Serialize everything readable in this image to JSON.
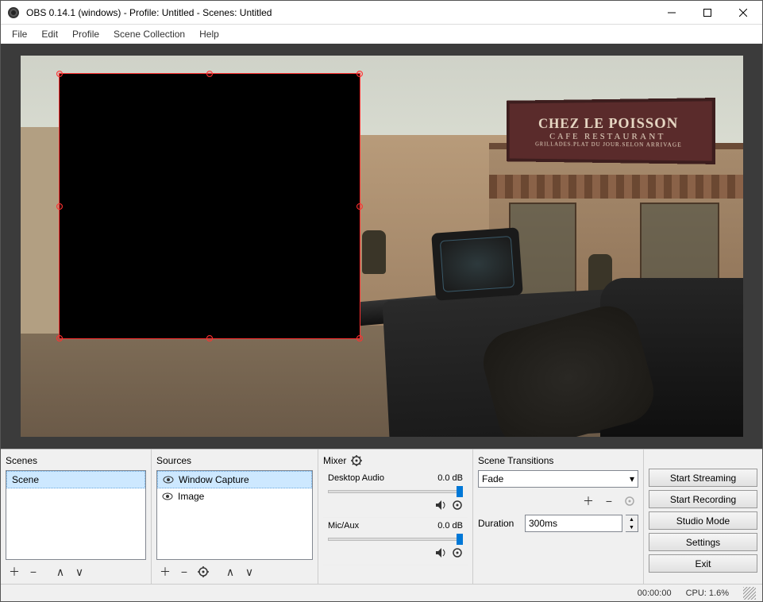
{
  "titlebar": {
    "title": "OBS 0.14.1 (windows) - Profile: Untitled - Scenes: Untitled"
  },
  "menubar": {
    "items": [
      "File",
      "Edit",
      "Profile",
      "Scene Collection",
      "Help"
    ]
  },
  "preview": {
    "sign": {
      "line1": "CHEZ LE POISSON",
      "line2": "CAFE   RESTAURANT",
      "line3": "GRILLADES.PLAT DU JOUR.SELON ARRIVAGE"
    }
  },
  "panels": {
    "scenes": {
      "header": "Scenes",
      "items": [
        "Scene"
      ]
    },
    "sources": {
      "header": "Sources",
      "items": [
        "Window Capture",
        "Image"
      ]
    },
    "mixer": {
      "header": "Mixer",
      "channels": [
        {
          "name": "Desktop Audio",
          "level": "0.0 dB"
        },
        {
          "name": "Mic/Aux",
          "level": "0.0 dB"
        }
      ]
    },
    "transitions": {
      "header": "Scene Transitions",
      "selected": "Fade",
      "duration_label": "Duration",
      "duration_value": "300ms"
    },
    "controls": {
      "buttons": [
        "Start Streaming",
        "Start Recording",
        "Studio Mode",
        "Settings",
        "Exit"
      ]
    }
  },
  "statusbar": {
    "time": "00:00:00",
    "cpu": "CPU: 1.6%"
  }
}
